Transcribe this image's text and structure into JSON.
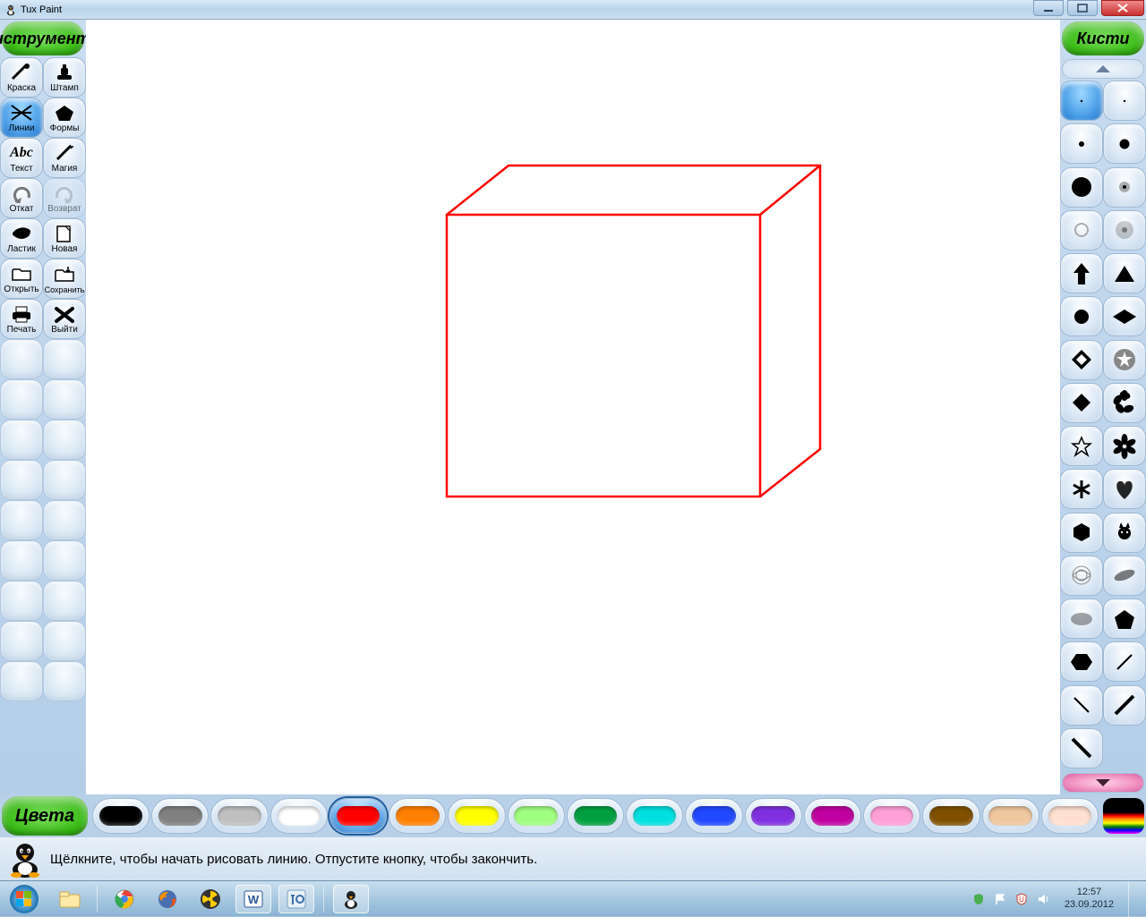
{
  "window": {
    "title": "Tux Paint"
  },
  "panels": {
    "tools": "Инструменты",
    "brushes": "Кисти",
    "colors": "Цвета"
  },
  "tools": [
    {
      "id": "paint",
      "label": "Краска"
    },
    {
      "id": "stamp",
      "label": "Штамп"
    },
    {
      "id": "lines",
      "label": "Линии",
      "selected": true
    },
    {
      "id": "shapes",
      "label": "Формы"
    },
    {
      "id": "text",
      "label": "Текст"
    },
    {
      "id": "magic",
      "label": "Магия"
    },
    {
      "id": "undo",
      "label": "Откат"
    },
    {
      "id": "redo",
      "label": "Возврат",
      "disabled": true
    },
    {
      "id": "eraser",
      "label": "Ластик"
    },
    {
      "id": "new",
      "label": "Новая"
    },
    {
      "id": "open",
      "label": "Открыть"
    },
    {
      "id": "save",
      "label": "Сохранить"
    },
    {
      "id": "print",
      "label": "Печать"
    },
    {
      "id": "quit",
      "label": "Выйти"
    }
  ],
  "colors": [
    "#000000",
    "#808080",
    "#c0c0c0",
    "#ffffff",
    "#ff0000",
    "#ff8000",
    "#ffff00",
    "#a0ff80",
    "#00a040",
    "#00e0e0",
    "#2048ff",
    "#8030e0",
    "#c000a0",
    "#ffa0d8",
    "#805000",
    "#f0c8a0",
    "#ffe0d0"
  ],
  "selected_color_index": 4,
  "status": {
    "text": "Щёлкните, чтобы начать рисовать линию. Отпустите кнопку, чтобы закончить."
  },
  "brushes": {
    "selected_index": 0,
    "items": [
      "dot-tiny",
      "dot-tiny",
      "dot-small",
      "dot-med",
      "circle-large",
      "fuzzy",
      "ring",
      "fuzzy-big",
      "arrow-up",
      "triangle",
      "disc",
      "diamond",
      "diamond-outline",
      "star-circle",
      "rhombus",
      "flower5",
      "flower5-outline",
      "flower6",
      "asterisk",
      "heart",
      "hexagon",
      "cat",
      "spiro",
      "blur-line",
      "blur-oval",
      "pentagon",
      "hex2",
      "slash-thin-r",
      "slash-thin-l",
      "slash-thick-r",
      "slash-thick-l"
    ]
  },
  "taskbar": {
    "time": "12:57",
    "date": "23.09.2012"
  }
}
